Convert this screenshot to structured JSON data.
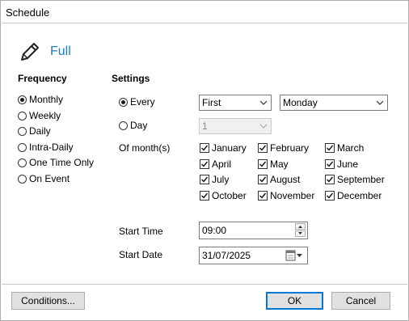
{
  "window": {
    "title": "Schedule"
  },
  "mode": {
    "label": "Full",
    "icon": "pencil-icon"
  },
  "frequency": {
    "header": "Frequency",
    "selected": "Monthly",
    "options": [
      "Monthly",
      "Weekly",
      "Daily",
      "Intra-Daily",
      "One Time Only",
      "On Event"
    ]
  },
  "settings": {
    "header": "Settings",
    "every_label": "Every",
    "day_label": "Day",
    "selected_option": "Every",
    "every_ordinal": "First",
    "every_weekday": "Monday",
    "day_value": "1",
    "months_label": "Of month(s)",
    "months": [
      {
        "name": "January",
        "checked": true
      },
      {
        "name": "February",
        "checked": true
      },
      {
        "name": "March",
        "checked": true
      },
      {
        "name": "April",
        "checked": true
      },
      {
        "name": "May",
        "checked": true
      },
      {
        "name": "June",
        "checked": true
      },
      {
        "name": "July",
        "checked": true
      },
      {
        "name": "August",
        "checked": true
      },
      {
        "name": "September",
        "checked": true
      },
      {
        "name": "October",
        "checked": true
      },
      {
        "name": "November",
        "checked": true
      },
      {
        "name": "December",
        "checked": true
      }
    ],
    "start_time_label": "Start Time",
    "start_time": "09:00",
    "start_date_label": "Start Date",
    "start_date": "31/07/2025"
  },
  "buttons": {
    "conditions": "Conditions...",
    "ok": "OK",
    "cancel": "Cancel"
  },
  "colors": {
    "accent": "#1e7fc4",
    "default_button_border": "#0078d7"
  }
}
